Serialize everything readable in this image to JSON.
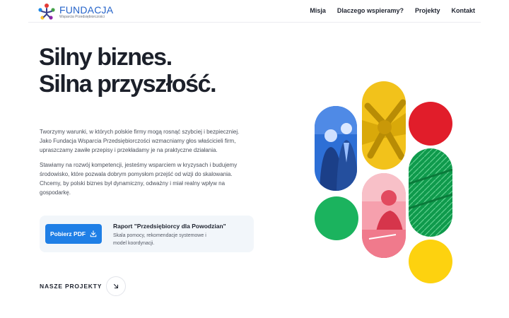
{
  "header": {
    "logo_title": "FUNDACJA",
    "logo_subtitle": "Wsparcia Przedsiębiorczości",
    "nav": [
      "Misja",
      "Dlaczego wspieramy?",
      "Projekty",
      "Kontakt"
    ]
  },
  "hero": {
    "headline_line1": "Silny biznes.",
    "headline_line2": "Silna przyszłość.",
    "paragraph1": "Tworzymy warunki, w których polskie firmy mogą rosnąć szybciej i bezpieczniej. Jako Fundacja Wsparcia Przedsiębiorczości wzmacniamy głos właścicieli firm, upraszczamy zawiłe przepisy i przekładamy je na praktyczne działania.",
    "paragraph2": "Stawiamy na rozwój kompetencji, jesteśmy wsparciem w kryzysach i budujemy środowisko, które pozwala dobrym pomysłom przejść od wizji do skalowania. Chcemy, by polski biznes był dynamiczny, odważny i miał realny wpływ na gospodarkę."
  },
  "report_card": {
    "button_label": "Pobierz PDF",
    "title": "Raport \"Przedsiębiorcy dla Powodzian\"",
    "description": "Skala pomocy, rekomendacje systemowe i model koordynacji."
  },
  "projects_link": {
    "label": "NASZE PROJEKTY",
    "icon": "arrow-down-right-icon"
  },
  "collage": {
    "colors": {
      "blue": "#2d6fd6",
      "yellow": "#f2c21b",
      "red": "#e11d2a",
      "green": "#1bb35e",
      "pink": "#f06a7c",
      "green_dark": "#0f9a4c",
      "yellow_circle": "#fdd20f"
    }
  },
  "colors": {
    "accent": "#1f7fe6",
    "text": "#1f2430",
    "card_bg": "#f2f6fa"
  }
}
